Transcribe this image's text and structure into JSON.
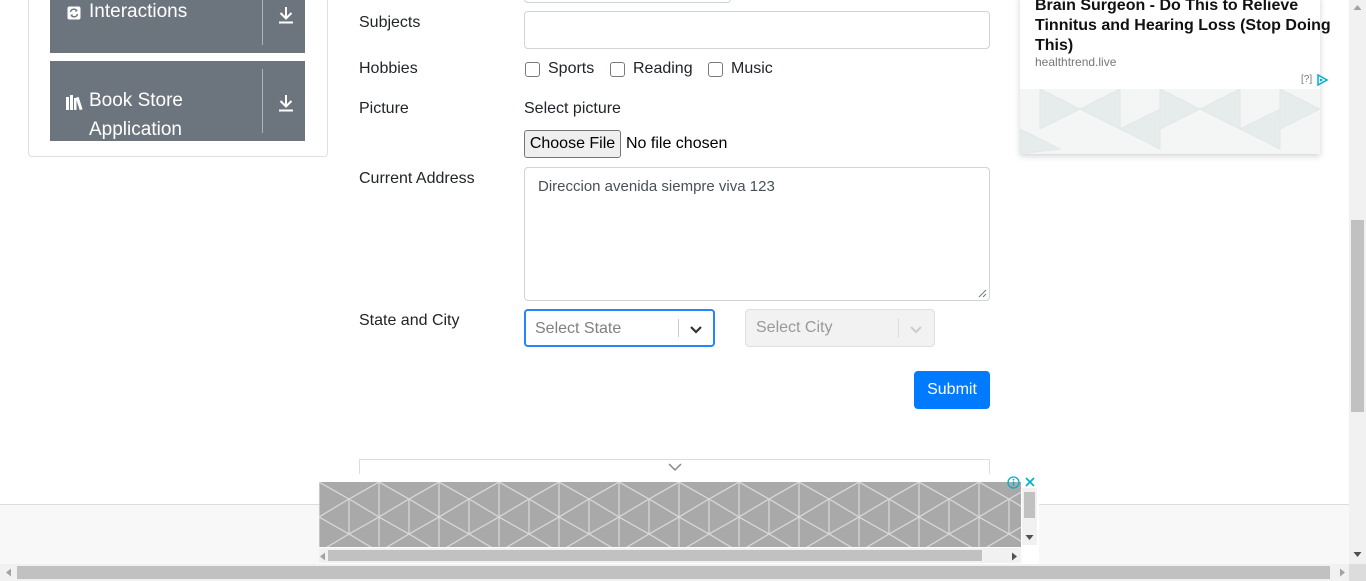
{
  "sidebar": {
    "items": [
      {
        "label": "Interactions",
        "icon": "interactions-icon"
      },
      {
        "label_line1": "Book Store",
        "label_line2": "Application",
        "icon": "book-icon"
      }
    ]
  },
  "form": {
    "subjects_label": "Subjects",
    "subjects_value": "",
    "hobbies_label": "Hobbies",
    "hobbies": [
      {
        "label": "Sports",
        "checked": false
      },
      {
        "label": "Reading",
        "checked": false
      },
      {
        "label": "Music",
        "checked": false
      }
    ],
    "picture_label": "Picture",
    "select_picture_text": "Select picture",
    "choose_file_label": "Choose File",
    "no_file_text": "No file chosen",
    "current_address_label": "Current Address",
    "current_address_value": "Direccion avenida siempre viva 123",
    "state_city_label": "State and City",
    "state_placeholder": "Select State",
    "city_placeholder": "Select City",
    "submit_label": "Submit"
  },
  "right_ad": {
    "title": "Brain Surgeon - Do This to Relieve Tinnitus and Hearing Loss (Stop Doing This)",
    "source": "healthtrend.live",
    "help": "[?]"
  },
  "colors": {
    "primary": "#007bff",
    "sidebar_btn": "#6c757d",
    "focus_border": "#2684ff",
    "ad_teal": "#00aecd"
  }
}
